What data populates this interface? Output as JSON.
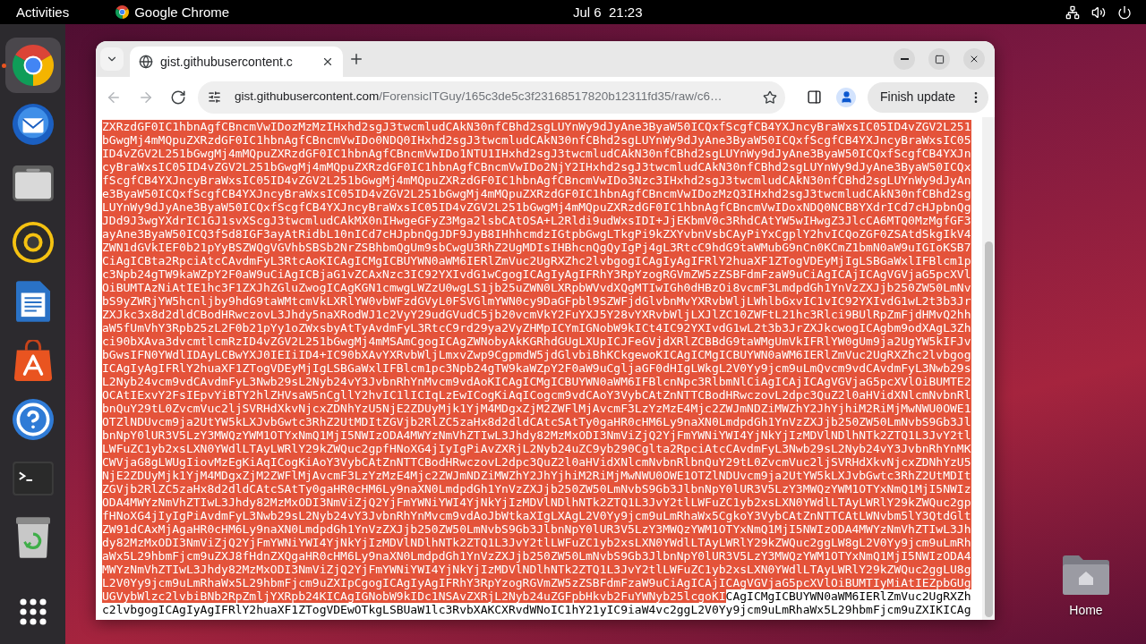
{
  "top_bar": {
    "activities": "Activities",
    "app_name": "Google Chrome",
    "clock": "Jul 6  21:23"
  },
  "dock": [
    {
      "kind": "chrome",
      "active": true
    },
    {
      "kind": "mail",
      "active": false
    },
    {
      "kind": "files",
      "active": false
    },
    {
      "kind": "music",
      "active": false
    },
    {
      "kind": "writer",
      "active": false
    },
    {
      "kind": "store",
      "active": false
    },
    {
      "kind": "help",
      "active": false
    },
    {
      "kind": "terminal",
      "active": false
    },
    {
      "kind": "trash",
      "active": false
    },
    {
      "kind": "apps",
      "active": false
    }
  ],
  "browser": {
    "tabs": [
      {
        "title": "gist.githubusercontent.c",
        "selected": true
      }
    ],
    "nav_buttons": [
      {
        "kind": "back",
        "disabled": true
      },
      {
        "kind": "forward",
        "disabled": true
      },
      {
        "kind": "reload",
        "disabled": false
      }
    ],
    "address": {
      "host": "gist.githubusercontent.com",
      "path": "/ForensicITGuy/165c3de5c3f23168517820b12311fd35/raw/c6…"
    },
    "update_button": "Finish update",
    "page": {
      "lines": [
        {
          "parts": [
            {
              "text": "ZXRzdGF0IC1hbnAgfCBncmVwIDozMzMzIHxhd2sgJ3twcmludCAkN30nfCBhd2sgLUYnWy9dJyAne3ByaW50ICQxfScgfCB4YXJncyBraWxsIC05ID4vZGV2L251",
              "selected": true
            }
          ]
        },
        {
          "parts": [
            {
              "text": "bGwgMj4mMQpuZXRzdGF0IC1hbnAgfCBncmVwIDo0NDQ0IHxhd2sgJ3twcmludCAkN30nfCBhd2sgLUYnWy9dJyAne3ByaW50ICQxfScgfCB4YXJncyBraWxsIC05",
              "selected": true
            }
          ]
        },
        {
          "parts": [
            {
              "text": "ID4vZGV2L251bGwgMj4mMQpuZXRzdGF0IC1hbnAgfCBncmVwIDo1NTU1IHxhd2sgJ3twcmludCAkN30nfCBhd2sgLUYnWy9dJyAne3ByaW50ICQxfScgfCB4YXJn",
              "selected": true
            }
          ]
        },
        {
          "parts": [
            {
              "text": "cyBraWxsIC05ID4vZGV2L251bGwgMj4mMQpuZXRzdGF0IC1hbnAgfCBncmVwIDo2NjY2IHxhd2sgJ3twcmludCAkN30nfCBhd2sgLUYnWy9dJyAne3ByaW50ICQx",
              "selected": true
            }
          ]
        },
        {
          "parts": [
            {
              "text": "fScgfCB4YXJncyBraWxsIC05ID4vZGV2L251bGwgMj4mMQpuZXRzdGF0IC1hbnAgfCBncmVwIDo3Nzc3IHxhd2sgJ3twcmludCAkN30nfCBhd2sgLUYnWy9dJyAn",
              "selected": true
            }
          ]
        },
        {
          "parts": [
            {
              "text": "e3ByaW50ICQxfScgfCB4YXJncyBraWxsIC05ID4vZGV2L251bGwgMj4mMQpuZXRzdGF0IC1hbnAgfCBncmVwIDozMzQ3IHxhd2sgJ3twcmludCAkN30nfCBhd2sg",
              "selected": true
            }
          ]
        },
        {
          "parts": [
            {
              "text": "LUYnWy9dJyAne3ByaW50ICQxfScgfCB4YXJncyBraWxsIC05ID4vZGV2L251bGwgMj4mMQpuZXRzdGF0IC1hbnAgfCBncmVwIDoxNDQ0NCB8YXdrICd7cHJpbnQg",
              "selected": true
            }
          ]
        },
        {
          "parts": [
            {
              "text": "JDd9J3wgYXdrIC1GJ1svXScgJ3twcmludCAkMX0nIHwgeGFyZ3Mga2lsbCAtOSA+L2Rldi9udWxsIDI+JjEKbmV0c3RhdCAtYW5wIHwgZ3JlcCA6MTQ0MzMgfGF3",
              "selected": true
            }
          ]
        },
        {
          "parts": [
            {
              "text": "ayAne3ByaW50ICQ3fSd8IGF3ayAtRidbL10nICd7cHJpbnQgJDF9JyB8IHhhcmdzIGtpbGwgLTkgPi9kZXYvbnVsbCAyPiYxCgplY2hvICQoZGF0ZSAtdSkgIkV4",
              "selected": true
            }
          ]
        },
        {
          "parts": [
            {
              "text": "ZWN1dGVkIEF0b21pYyBSZWQgVGVhbSBSb2NrZSBhbmQgUm9sbCwgU3RhZ2UgMDIsIHBhcnQgQyIgPj4gL3RtcC9hdG9taWMubG9nCn0KCmZ1bmN0aW9uIGIoKSB7",
              "selected": true
            }
          ]
        },
        {
          "parts": [
            {
              "text": "CiAgICBta2RpciAtcCAvdmFyL3RtcAoKICAgICMgICBUYWN0aWM6IERlZmVuc2UgRXZhc2lvbgogICAgIyAgIFRlY2huaXF1ZTogVDEyMjIgLSBGaWxlIFBlcm1p",
              "selected": true
            }
          ]
        },
        {
          "parts": [
            {
              "text": "c3Npb24gTW9kaWZpY2F0aW9uCiAgICBjaG1vZCAxNzc3IC92YXIvdG1wCgogICAgIyAgIFRhY3RpYzogRGVmZW5zZSBFdmFzaW9uCiAgICAjICAgVGVjaG5pcXVl",
              "selected": true
            }
          ]
        },
        {
          "parts": [
            {
              "text": "OiBUMTAzNiAtIE1hc3F1ZXJhZGluZwogICAgKGN1cmwgLWZzU0wgLS1jb25uZWN0LXRpbWVvdXQgMTIwIGh0dHBzOi8vcmF3LmdpdGh1YnVzZXJjb250ZW50LmNv",
              "selected": true
            }
          ]
        },
        {
          "parts": [
            {
              "text": "bS9yZWRjYW5hcnljby9hdG9taWMtcmVkLXRlYW0vbWFzdGVyL0FSVGlmYWN0cy9DaGFpbl9SZWFjdGlvbnMvYXRvbWljLWhlbGxvIC1vIC92YXIvdG1wL2t3b3Jr",
              "selected": true
            }
          ]
        },
        {
          "parts": [
            {
              "text": "ZXJkc3x8d2dldCBodHRwczovL3Jhdy5naXRodWJ1c2VyY29udGVudC5jb20vcmVkY2FuYXJ5Y28vYXRvbWljLXJlZC10ZWFtL21hc3Rlci9BUlRpZmFjdHMvQ2hh",
              "selected": true
            }
          ]
        },
        {
          "parts": [
            {
              "text": "aW5fUmVhY3Rpb25zL2F0b21pYy1oZWxsbyAtTyAvdmFyL3RtcC9rd29ya2VyZHMpICYmIGNobW9kICt4IC92YXIvdG1wL2t3b3JrZXJkcwogICAgbm9odXAgL3Zh",
              "selected": true
            }
          ]
        },
        {
          "parts": [
            {
              "text": "ci90bXAva3dvcmtlcmRzID4vZGV2L251bGwgMj4mMSAmCgogICAgZWNobyAkKGRhdGUgLXUpICJFeGVjdXRlZCBBdG9taWMgUmVkIFRlYW0gUm9ja2UgYW5kIFJv",
              "selected": true
            }
          ]
        },
        {
          "parts": [
            {
              "text": "bGwsIFN0YWdlIDAyLCBwYXJ0IEIiID4+IC90bXAvYXRvbWljLmxvZwp9CgpmdW5jdGlvbiBhKCkgewoKICAgICMgICBUYWN0aWM6IERlZmVuc2UgRXZhc2lvbgog",
              "selected": true
            }
          ]
        },
        {
          "parts": [
            {
              "text": "ICAgIyAgIFRlY2huaXF1ZTogVDEyMjIgLSBGaWxlIFBlcm1pc3Npb24gTW9kaWZpY2F0aW9uCgljaGF0dHIgLWkgL2V0Yy9jcm9uLmQvcm9vdCAvdmFyL3Nwb29s",
              "selected": true
            }
          ]
        },
        {
          "parts": [
            {
              "text": "L2Nyb24vcm9vdCAvdmFyL3Nwb29sL2Nyb24vY3JvbnRhYnMvcm9vdAoKICAgICMgICBUYWN0aWM6IFBlcnNpc3RlbmNlCiAgICAjICAgVGVjaG5pcXVlOiBUMTE2",
              "selected": true
            }
          ]
        },
        {
          "parts": [
            {
              "text": "OCAtIExvY2FsIEpvYiBTY2hlZHVsaW5nCgllY2hvIC1lICIqLzEwICogKiAqICogcm9vdCAoY3VybCAtZnNTTCBodHRwczovL2dpc3QuZ2l0aHVidXNlcmNvbnRl",
              "selected": true
            }
          ]
        },
        {
          "parts": [
            {
              "text": "bnQuY29tL0ZvcmVuc2ljSVRHdXkvNjcxZDNhYzU5NjE2ZDUyMjk1YjM4MDgxZjM2ZWFlMjAvcmF3LzYzMzE4Mjc2ZWJmNDZiMWZhY2JhYjhiM2RiMjMwNWU0OWE1",
              "selected": true
            }
          ]
        },
        {
          "parts": [
            {
              "text": "OTZlNDUvcm9ja2UtYW5kLXJvbGwtc3RhZ2UtMDItZGVjb2RlZC5zaHx8d2dldCAtcSAtTy0gaHR0cHM6Ly9naXN0LmdpdGh1YnVzZXJjb250ZW50LmNvbS9Gb3Jl",
              "selected": true
            }
          ]
        },
        {
          "parts": [
            {
              "text": "bnNpY0lUR3V5LzY3MWQzYWM1OTYxNmQ1MjI5NWIzODA4MWYzNmVhZTIwL3Jhdy82MzMxODI3NmViZjQ2YjFmYWNiYWI4YjNkYjIzMDVlNDlhNTk2ZTQ1L3JvY2tl",
              "selected": true
            }
          ]
        },
        {
          "parts": [
            {
              "text": "LWFuZC1yb2xsLXN0YWdlLTAyLWRlY29kZWQuc2gpfHNoXG4jIyIgPiAvZXRjL2Nyb24uZC9yb290Cglta2RpciAtcCAvdmFyL3Nwb29sL2Nyb24vY3JvbnRhYnMK",
              "selected": true
            }
          ]
        },
        {
          "parts": [
            {
              "text": "CWVjaG8gLWUgIiovMzEgKiAqICogKiAoY3VybCAtZnNTTCBodHRwczovL2dpc3QuZ2l0aHVidXNlcmNvbnRlbnQuY29tL0ZvcmVuc2ljSVRHdXkvNjcxZDNhYzU5",
              "selected": true
            }
          ]
        },
        {
          "parts": [
            {
              "text": "NjE2ZDUyMjk1YjM4MDgxZjM2ZWFlMjAvcmF3LzYzMzE4Mjc2ZWJmNDZiMWZhY2JhYjhiM2RiMjMwNWU0OWE1OTZlNDUvcm9ja2UtYW5kLXJvbGwtc3RhZ2UtMDIt",
              "selected": true
            }
          ]
        },
        {
          "parts": [
            {
              "text": "ZGVjb2RlZC5zaHx8d2dldCAtcSAtTy0gaHR0cHM6Ly9naXN0LmdpdGh1YnVzZXJjb250ZW50LmNvbS9Gb3JlbnNpY0lUR3V5LzY3MWQzYWM1OTYxNmQ1MjI5NWIz",
              "selected": true
            }
          ]
        },
        {
          "parts": [
            {
              "text": "ODA4MWYzNmVhZTIwL3Jhdy82MzMxODI3NmViZjQ2YjFmYWNiYWI4YjNkYjIzMDVlNDlhNTk2ZTQ1L3JvY2tlLWFuZC1yb2xsLXN0YWdlLTAyLWRlY29kZWQuc2gp",
              "selected": true
            }
          ]
        },
        {
          "parts": [
            {
              "text": "fHNoXG4jIyIgPiAvdmFyL3Nwb29sL2Nyb24vY3JvbnRhYnMvcm9vdAoJbWtkaXIgLXAgL2V0Yy9jcm9uLmRhaWx5CgkoY3VybCAtZnNTTCAtLWNvbm5lY3QtdGlt",
              "selected": true
            }
          ]
        },
        {
          "parts": [
            {
              "text": "ZW91dCAxMjAgaHR0cHM6Ly9naXN0LmdpdGh1YnVzZXJjb250ZW50LmNvbS9Gb3JlbnNpY0lUR3V5LzY3MWQzYWM1OTYxNmQ1MjI5NWIzODA4MWYzNmVhZTIwL3Jh",
              "selected": true
            }
          ]
        },
        {
          "parts": [
            {
              "text": "dy82MzMxODI3NmViZjQ2YjFmYWNiYWI4YjNkYjIzMDVlNDlhNTk2ZTQ1L3JvY2tlLWFuZC1yb2xsLXN0YWdlLTAyLWRlY29kZWQuc2ggLW8gL2V0Yy9jcm9uLmRh",
              "selected": true
            }
          ]
        },
        {
          "parts": [
            {
              "text": "aWx5L29hbmFjcm9uZXJ8fHdnZXQgaHR0cHM6Ly9naXN0LmdpdGh1YnVzZXJjb250ZW50LmNvbS9Gb3JlbnNpY0lUR3V5LzY3MWQzYWM1OTYxNmQ1MjI5NWIzODA4",
              "selected": true
            }
          ]
        },
        {
          "parts": [
            {
              "text": "MWYzNmVhZTIwL3Jhdy82MzMxODI3NmViZjQ2YjFmYWNiYWI4YjNkYjIzMDVlNDlhNTk2ZTQ1L3JvY2tlLWFuZC1yb2xsLXN0YWdlLTAyLWRlY29kZWQuc2ggLU8g",
              "selected": true
            }
          ]
        },
        {
          "parts": [
            {
              "text": "L2V0Yy9jcm9uLmRhaWx5L29hbmFjcm9uZXIpCgogICAgIyAgIFRhY3RpYzogRGVmZW5zZSBFdmFzaW9uCiAgICAjICAgVGVjaG5pcXVlOiBUMTIyMiAtIEZpbGUg",
              "selected": true
            }
          ]
        },
        {
          "parts": [
            {
              "text": "UGVybWlzc2lvbiBNb2RpZmljYXRpb24KICAgIGNobW9kIDc1NSAvZXRjL2Nyb24uZGFpbHkvb2FuYWNyb25lcgoKI",
              "selected": true
            },
            {
              "text": "CAgICMgICBUYWN0aWM6IERlZmVuc2UgRXZh",
              "selected": false
            }
          ]
        },
        {
          "parts": [
            {
              "text": "c2lvbgogICAgIyAgIFRlY2huaXF1ZTogVDEwOTkgLSBUaW1lc3RvbXAKCXRvdWNoIC1hY21yIC9iaW4vc2ggL2V0Yy9jcm9uLmRhaWx5L29hbmFjcm9uZXIKICAg",
              "selected": false
            }
          ]
        }
      ]
    }
  },
  "desktop_icons": [
    {
      "label": "Home"
    }
  ]
}
